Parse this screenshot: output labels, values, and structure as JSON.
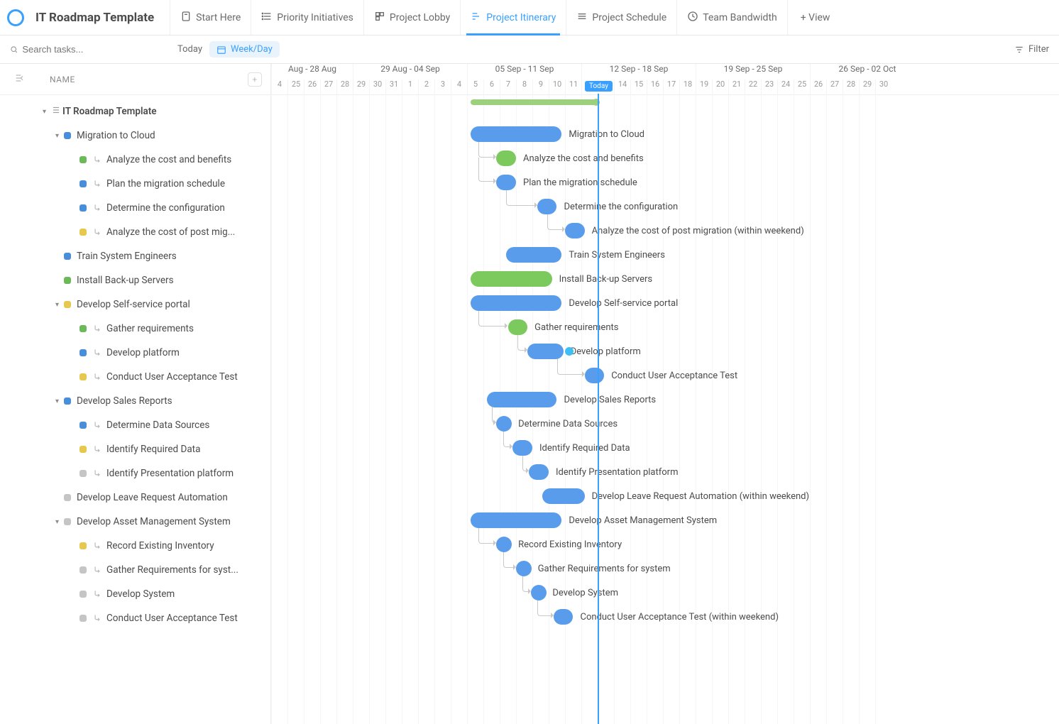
{
  "title": "IT Roadmap Template",
  "views": [
    {
      "label": "Start Here",
      "active": false
    },
    {
      "label": "Priority Initiatives",
      "active": false
    },
    {
      "label": "Project Lobby",
      "active": false
    },
    {
      "label": "Project Itinerary",
      "active": true
    },
    {
      "label": "Project Schedule",
      "active": false
    },
    {
      "label": "Team Bandwidth",
      "active": false
    }
  ],
  "add_view": "+ View",
  "search_placeholder": "Search tasks...",
  "today_btn": "Today",
  "zoom_btn": "Week/Day",
  "filter_btn": "Filter",
  "columns": {
    "name": "NAME"
  },
  "timeline": {
    "weeks": [
      {
        "label": "Aug - 28 Aug",
        "start": 0,
        "days": 5
      },
      {
        "label": "29 Aug - 04 Sep",
        "start": 5,
        "days": 7
      },
      {
        "label": "05 Sep - 11 Sep",
        "start": 12,
        "days": 7
      },
      {
        "label": "12 Sep - 18 Sep",
        "start": 19,
        "days": 7
      },
      {
        "label": "19 Sep - 25 Sep",
        "start": 26,
        "days": 7
      },
      {
        "label": "26 Sep - 02 Oct",
        "start": 33,
        "days": 7
      }
    ],
    "days": [
      "4",
      "25",
      "26",
      "27",
      "28",
      "29",
      "30",
      "31",
      "1",
      "2",
      "3",
      "4",
      "5",
      "6",
      "7",
      "8",
      "9",
      "10",
      "11",
      "12",
      "13",
      "14",
      "15",
      "16",
      "17",
      "18",
      "19",
      "20",
      "21",
      "22",
      "23",
      "24",
      "25",
      "26",
      "27",
      "28",
      "29",
      "30"
    ],
    "today_label": "Today",
    "today_day": 20,
    "summary_start": 12.2,
    "summary_end": 20
  },
  "tasks": [
    {
      "type": "root",
      "label": "IT Roadmap Template",
      "color": null,
      "indent": 0,
      "bar": null
    },
    {
      "type": "group",
      "label": "Migration to Cloud",
      "color": "blue",
      "indent": 1,
      "bar": {
        "start": 12.2,
        "len": 5.6,
        "color": "blue"
      }
    },
    {
      "type": "task",
      "label": "Analyze the cost and benefits",
      "color": "green",
      "indent": 2,
      "sub": true,
      "bar": {
        "start": 13.8,
        "len": 1.2,
        "color": "green"
      },
      "dep_from": 12.7
    },
    {
      "type": "task",
      "label": "Plan the migration schedule",
      "color": "blue",
      "indent": 2,
      "sub": true,
      "bar": {
        "start": 13.8,
        "len": 1.2,
        "color": "blue"
      },
      "dep_from": 12.7
    },
    {
      "type": "task",
      "label": "Determine the configuration",
      "color": "blue",
      "indent": 2,
      "sub": true,
      "bar": {
        "start": 16.3,
        "len": 1.2,
        "color": "blue"
      },
      "dep_from": 14.4
    },
    {
      "type": "task",
      "label": "Analyze the cost of post migration (within weekend)",
      "short": "Analyze the cost of post mig...",
      "color": "yellow",
      "indent": 2,
      "sub": true,
      "bar": {
        "start": 18.0,
        "len": 1.2,
        "color": "blue"
      },
      "dep_from": 16.9
    },
    {
      "type": "task",
      "label": "Train System Engineers",
      "color": "blue",
      "indent": 1,
      "bar": {
        "start": 14.4,
        "len": 3.4,
        "color": "blue"
      }
    },
    {
      "type": "task",
      "label": "Install Back-up Servers",
      "color": "green",
      "indent": 1,
      "bar": {
        "start": 12.2,
        "len": 5.0,
        "color": "green"
      }
    },
    {
      "type": "group",
      "label": "Develop Self-service portal",
      "color": "yellow",
      "indent": 1,
      "bar": {
        "start": 12.2,
        "len": 5.6,
        "color": "blue"
      }
    },
    {
      "type": "task",
      "label": "Gather requirements",
      "color": "green",
      "indent": 2,
      "sub": true,
      "bar": {
        "start": 14.5,
        "len": 1.2,
        "color": "green"
      },
      "dep_from": 12.7
    },
    {
      "type": "task",
      "label": "Develop platform",
      "color": "blue",
      "indent": 2,
      "sub": true,
      "bar": {
        "start": 15.7,
        "len": 2.2,
        "color": "blue"
      },
      "dep_from": 15.1,
      "extra_dot": 18.0
    },
    {
      "type": "task",
      "label": "Conduct User Acceptance Test",
      "color": "yellow",
      "indent": 2,
      "sub": true,
      "bar": {
        "start": 19.2,
        "len": 1.2,
        "color": "blue"
      },
      "dep_from": 17.5
    },
    {
      "type": "group",
      "label": "Develop Sales Reports",
      "color": "blue",
      "indent": 1,
      "bar": {
        "start": 13.2,
        "len": 4.3,
        "color": "blue"
      }
    },
    {
      "type": "task",
      "label": "Determine Data Sources",
      "color": "blue",
      "indent": 2,
      "sub": true,
      "bar": {
        "start": 13.8,
        "len": 0.9,
        "color": "blue"
      },
      "dep_from": 13.5
    },
    {
      "type": "task",
      "label": "Identify Required Data",
      "color": "yellow",
      "indent": 2,
      "sub": true,
      "bar": {
        "start": 14.8,
        "len": 1.2,
        "color": "blue"
      },
      "dep_from": 14.2
    },
    {
      "type": "task",
      "label": "Identify Presentation platform",
      "color": "grey",
      "indent": 2,
      "sub": true,
      "bar": {
        "start": 15.8,
        "len": 1.2,
        "color": "blue"
      },
      "dep_from": 15.4
    },
    {
      "type": "task",
      "label": "Develop Leave Request Automation (within weekend)",
      "short": "Develop Leave Request Automation",
      "color": "grey",
      "indent": 1,
      "bar": {
        "start": 16.6,
        "len": 2.6,
        "color": "blue"
      }
    },
    {
      "type": "group",
      "label": "Develop Asset Management System",
      "color": "grey",
      "indent": 1,
      "bar": {
        "start": 12.2,
        "len": 5.6,
        "color": "blue"
      }
    },
    {
      "type": "task",
      "label": "Record Existing Inventory",
      "color": "yellow",
      "indent": 2,
      "sub": true,
      "bar": {
        "start": 13.8,
        "len": 0.9,
        "color": "blue"
      },
      "dep_from": 12.7
    },
    {
      "type": "task",
      "label": "Gather Requirements for system",
      "short": "Gather Requirements for syst...",
      "color": "grey",
      "indent": 2,
      "sub": true,
      "bar": {
        "start": 15.0,
        "len": 0.9,
        "color": "blue"
      },
      "dep_from": 14.2
    },
    {
      "type": "task",
      "label": "Develop System",
      "color": "grey",
      "indent": 2,
      "sub": true,
      "bar": {
        "start": 15.9,
        "len": 0.9,
        "color": "blue"
      },
      "dep_from": 15.4
    },
    {
      "type": "task",
      "label": "Conduct User Acceptance Test (within weekend)",
      "short": "Conduct User Acceptance Test",
      "color": "grey",
      "indent": 2,
      "sub": true,
      "bar": {
        "start": 17.3,
        "len": 1.2,
        "color": "blue"
      },
      "dep_from": 16.3
    }
  ]
}
